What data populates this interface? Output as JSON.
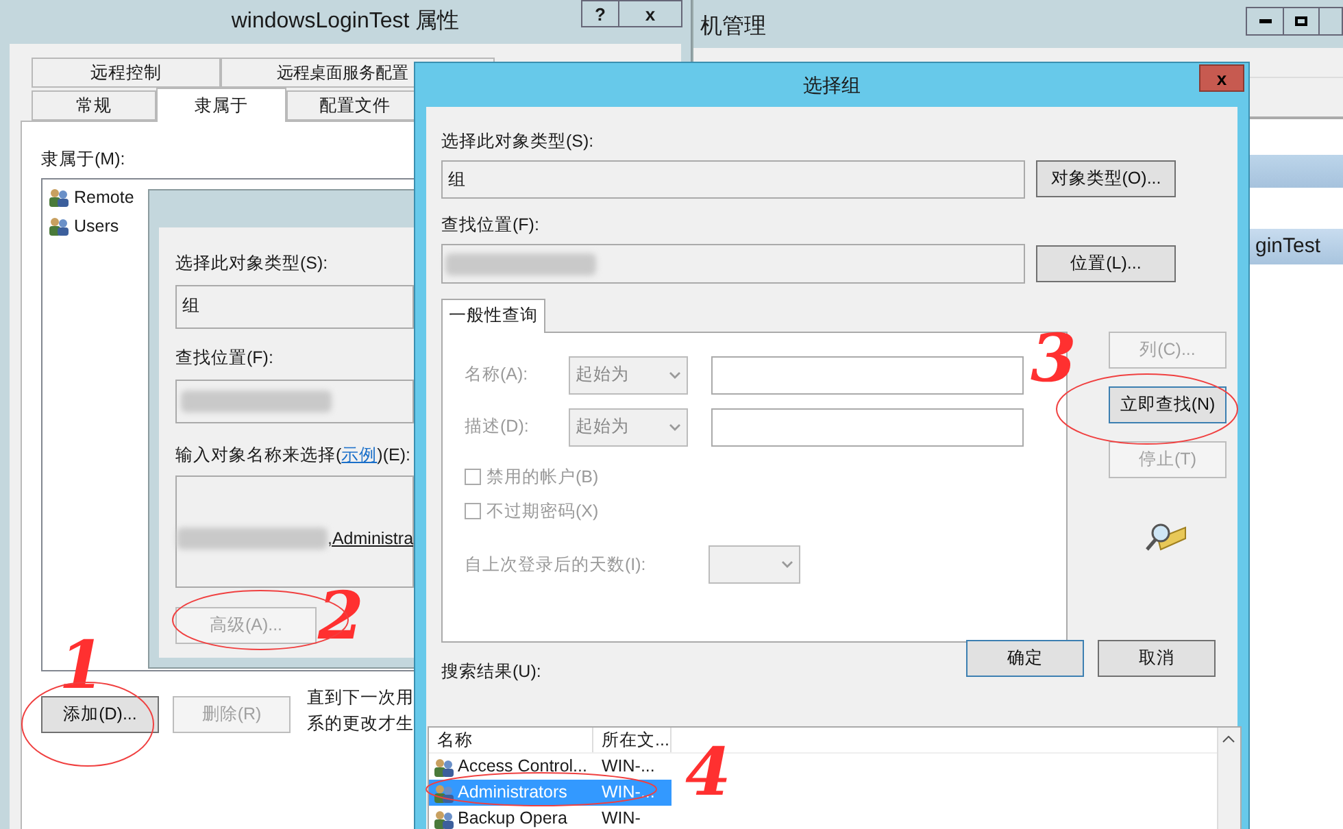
{
  "background_window": {
    "title": "机管理",
    "list_item": "ginTest"
  },
  "properties_window": {
    "title": "windowsLoginTest 属性",
    "help_button": "?",
    "close_button": "x",
    "tabs_row_1": [
      {
        "label": "远程控制",
        "selected": false
      },
      {
        "label": "远程桌面服务配置",
        "selected": false
      }
    ],
    "tabs_row_2": [
      {
        "label": "常规",
        "selected": false
      },
      {
        "label": "隶属于",
        "selected": true
      },
      {
        "label": "配置文件",
        "selected": false
      }
    ],
    "member_of_label": "隶属于(M):",
    "groups": [
      "Remote",
      "Users"
    ],
    "buttons": [
      {
        "label": "添加(D)...",
        "disabled": false
      },
      {
        "label": "删除(R)",
        "disabled": true
      }
    ],
    "note_lines": [
      "直到下一次用",
      "系的更改才生"
    ]
  },
  "select_users_dialog": {
    "object_type_label": "选择此对象类型(S):",
    "object_type": "组",
    "location_label": "查找位置(F):",
    "names_label_start": "输入对象名称来选择(",
    "example_link": "示例",
    "names_label_end": ")(E):",
    "names_value": ",Administra",
    "advanced_button": {
      "label": "高级(A)...",
      "disabled": true
    }
  },
  "select_group_dialog": {
    "title": "选择组",
    "close_button": "x",
    "object_type_label": "选择此对象类型(S):",
    "object_type": "组",
    "object_type_button": "对象类型(O)...",
    "location_label": "查找位置(F):",
    "location_button": "位置(L)...",
    "query_tab": {
      "label": "一般性查询",
      "selected": true
    },
    "query_rows": [
      {
        "label": "名称(A):",
        "operator": "起始为"
      },
      {
        "label": "描述(D):",
        "operator": "起始为"
      }
    ],
    "checkboxes": [
      {
        "label": "禁用的帐户(B)",
        "checked": false
      },
      {
        "label": "不过期密码(X)",
        "checked": false
      }
    ],
    "days_label": "自上次登录后的天数(I):",
    "side_buttons": [
      {
        "label": "列(C)...",
        "disabled": true
      },
      {
        "label": "立即查找(N)",
        "disabled": false
      },
      {
        "label": "停止(T)",
        "disabled": true
      }
    ],
    "ok_button": "确定",
    "cancel_button": "取消",
    "results_label": "搜索结果(U):",
    "results_columns": [
      "名称",
      "所在文..."
    ],
    "results_rows": [
      {
        "name": "Access Control...",
        "folder": "WIN-...",
        "selected": false
      },
      {
        "name": "Administrators",
        "folder": "WIN-...",
        "selected": true
      },
      {
        "name": "Backup Opera",
        "folder": "WIN-",
        "selected": false
      }
    ]
  },
  "annotations": [
    {
      "label": "1"
    },
    {
      "label": "2"
    },
    {
      "label": "3"
    },
    {
      "label": "4"
    }
  ]
}
